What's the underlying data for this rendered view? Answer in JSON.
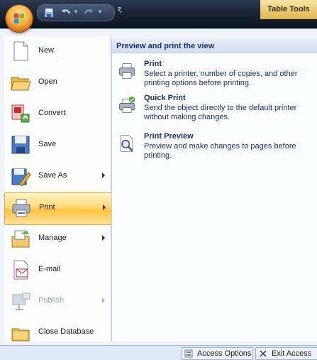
{
  "titlebar": {
    "context_tab": "Table Tools"
  },
  "commands": [
    {
      "label": "New",
      "icon": "new-document-icon",
      "submenu": false
    },
    {
      "label": "Open",
      "icon": "open-folder-icon",
      "submenu": false
    },
    {
      "label": "Convert",
      "icon": "convert-icon",
      "submenu": false
    },
    {
      "label": "Save",
      "icon": "save-icon",
      "submenu": false
    },
    {
      "label": "Save As",
      "icon": "save-as-icon",
      "submenu": true
    },
    {
      "label": "Print",
      "icon": "printer-icon",
      "submenu": true,
      "selected": true
    },
    {
      "label": "Manage",
      "icon": "manage-icon",
      "submenu": true
    },
    {
      "label": "E-mail",
      "icon": "email-icon",
      "submenu": false
    },
    {
      "label": "Publish",
      "icon": "publish-icon",
      "submenu": true,
      "disabled": true
    },
    {
      "label": "Close Database",
      "icon": "close-database-icon",
      "submenu": false
    }
  ],
  "submenu": {
    "header": "Preview and print the view",
    "options": [
      {
        "title": "Print",
        "desc": "Select a printer, number of copies, and other printing options before printing.",
        "icon": "printer-icon"
      },
      {
        "title": "Quick Print",
        "desc": "Send the object directly to the default printer without making changes.",
        "icon": "quick-print-icon"
      },
      {
        "title": "Print Preview",
        "desc": "Preview and make changes to pages before printing.",
        "icon": "print-preview-icon"
      }
    ]
  },
  "bottom": {
    "options_label": "Access Options",
    "exit_label": "Exit Access"
  },
  "colors": {
    "selected_highlight": "#ffc340",
    "header_text": "#15316e",
    "titlebar_dark": "#1c2535"
  }
}
